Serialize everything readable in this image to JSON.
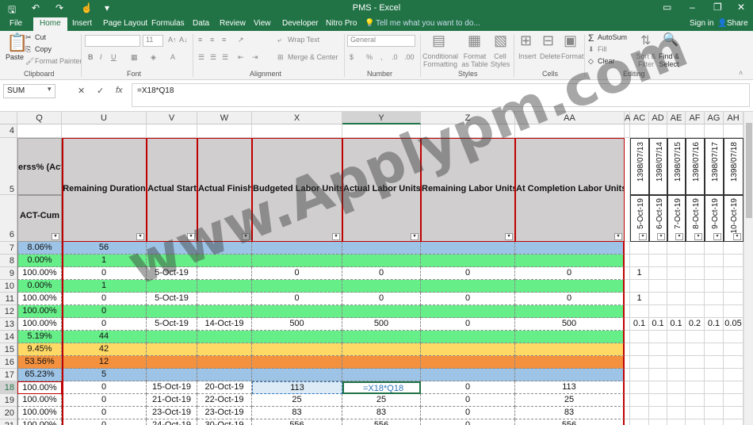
{
  "title": "PMS - Excel",
  "window_buttons": {
    "restore_ribbon": "▭",
    "minimize": "–",
    "maximize": "❐",
    "close": "✕"
  },
  "tabs": [
    "File",
    "Home",
    "Insert",
    "Page Layout",
    "Formulas",
    "Data",
    "Review",
    "View",
    "Developer",
    "Nitro Pro"
  ],
  "tell_me": "Tell me what you want to do...",
  "sign_in": "Sign in",
  "share": "Share",
  "ribbon": {
    "clipboard": {
      "paste": "Paste",
      "cut": "Cut",
      "copy": "Copy",
      "format_painter": "Format Painter",
      "label": "Clipboard"
    },
    "font": {
      "name": "",
      "size": "11",
      "label": "Font",
      "bold": "B",
      "italic": "I",
      "underline": "U"
    },
    "alignment": {
      "wrap": "Wrap Text",
      "merge": "Merge & Center",
      "label": "Alignment"
    },
    "number": {
      "format": "General",
      "label": "Number",
      "currency": "$",
      "percent": "%",
      "comma": ","
    },
    "styles": {
      "conditional": "Conditional Formatting",
      "format_table": "Format as Table",
      "cell_styles": "Cell Styles",
      "label": "Styles"
    },
    "cells": {
      "insert": "Insert",
      "delete": "Delete",
      "format": "Format",
      "label": "Cells"
    },
    "editing": {
      "autosum": "AutoSum",
      "fill": "Fill",
      "clear": "Clear",
      "sort": "Sort & Filter",
      "find": "Find & Select",
      "label": "Editing"
    }
  },
  "name_box": "SUM",
  "formula": "=X18*Q18",
  "formula_buttons": {
    "cancel": "✕",
    "enter": "✓",
    "fx": "fx"
  },
  "columns": [
    "Q",
    "U",
    "V",
    "W",
    "X",
    "Y",
    "Z",
    "AA",
    "A",
    "AC",
    "AD",
    "AE",
    "AF",
    "AG",
    "AH"
  ],
  "header_row5": [
    "erss% (Actu",
    "Remaining Duration",
    "Actual Start",
    "Actual Finish",
    "Budgeted Labor Units",
    "Actual Labor Units",
    "Remaining Labor Units",
    "At Completion Labor Units"
  ],
  "header_row6_q": "ACT-Cum",
  "date_headers_top": [
    "1398/07/13",
    "1398/07/14",
    "1398/07/15",
    "1398/07/16",
    "1398/07/17",
    "1398/07/18"
  ],
  "date_headers_bottom": [
    "5-Oct-19",
    "6-Oct-19",
    "7-Oct-19",
    "8-Oct-19",
    "9-Oct-19",
    "10-Oct-19"
  ],
  "rows": [
    {
      "n": "4",
      "q": "",
      "u": "",
      "v": "",
      "w": "",
      "x": "",
      "y": "",
      "z": "",
      "aa": "",
      "extra": [],
      "color": "#ffffff"
    },
    {
      "n": "7",
      "q": "8.06%",
      "u": "56",
      "v": "",
      "w": "",
      "x": "",
      "y": "",
      "z": "",
      "aa": "",
      "extra": [],
      "color": "#9dc3e6"
    },
    {
      "n": "8",
      "q": "0.00%",
      "u": "1",
      "v": "",
      "w": "",
      "x": "",
      "y": "",
      "z": "",
      "aa": "",
      "extra": [],
      "color": "#66ee88"
    },
    {
      "n": "9",
      "q": "100.00%",
      "u": "0",
      "v": "5-Oct-19",
      "w": "",
      "x": "0",
      "y": "0",
      "z": "0",
      "aa": "0",
      "extra": [
        "1"
      ],
      "color": "#ffffff"
    },
    {
      "n": "10",
      "q": "0.00%",
      "u": "1",
      "v": "",
      "w": "",
      "x": "",
      "y": "",
      "z": "",
      "aa": "",
      "extra": [],
      "color": "#66ee88"
    },
    {
      "n": "11",
      "q": "100.00%",
      "u": "0",
      "v": "5-Oct-19",
      "w": "",
      "x": "0",
      "y": "0",
      "z": "0",
      "aa": "0",
      "extra": [
        "1"
      ],
      "color": "#ffffff"
    },
    {
      "n": "12",
      "q": "100.00%",
      "u": "0",
      "v": "",
      "w": "",
      "x": "",
      "y": "",
      "z": "",
      "aa": "",
      "extra": [],
      "color": "#66ee88"
    },
    {
      "n": "13",
      "q": "100.00%",
      "u": "0",
      "v": "5-Oct-19",
      "w": "14-Oct-19",
      "x": "500",
      "y": "500",
      "z": "0",
      "aa": "500",
      "extra": [
        "0.1",
        "0.1",
        "0.1",
        "0.2",
        "0.1",
        "0.05"
      ],
      "color": "#ffffff"
    },
    {
      "n": "14",
      "q": "5.19%",
      "u": "44",
      "v": "",
      "w": "",
      "x": "",
      "y": "",
      "z": "",
      "aa": "",
      "extra": [],
      "color": "#66ee88"
    },
    {
      "n": "15",
      "q": "9.45%",
      "u": "42",
      "v": "",
      "w": "",
      "x": "",
      "y": "",
      "z": "",
      "aa": "",
      "extra": [],
      "color": "#ffd966"
    },
    {
      "n": "16",
      "q": "53.56%",
      "u": "12",
      "v": "",
      "w": "",
      "x": "",
      "y": "",
      "z": "",
      "aa": "",
      "extra": [],
      "color": "#f4913e"
    },
    {
      "n": "17",
      "q": "65.23%",
      "u": "5",
      "v": "",
      "w": "",
      "x": "",
      "y": "",
      "z": "",
      "aa": "",
      "extra": [],
      "color": "#9dc3e6"
    },
    {
      "n": "18",
      "q": "100.00%",
      "u": "0",
      "v": "15-Oct-19",
      "w": "20-Oct-19",
      "x": "113",
      "y": "=X18*Q18",
      "z": "0",
      "aa": "113",
      "extra": [],
      "color": "#ffffff"
    },
    {
      "n": "19",
      "q": "100.00%",
      "u": "0",
      "v": "21-Oct-19",
      "w": "22-Oct-19",
      "x": "25",
      "y": "25",
      "z": "0",
      "aa": "25",
      "extra": [],
      "color": "#ffffff"
    },
    {
      "n": "20",
      "q": "100.00%",
      "u": "0",
      "v": "23-Oct-19",
      "w": "23-Oct-19",
      "x": "83",
      "y": "83",
      "z": "0",
      "aa": "83",
      "extra": [],
      "color": "#ffffff"
    },
    {
      "n": "21",
      "q": "100.00%",
      "u": "0",
      "v": "24-Oct-19",
      "w": "30-Oct-19",
      "x": "556",
      "y": "556",
      "z": "0",
      "aa": "556",
      "extra": [],
      "color": "#ffffff"
    }
  ],
  "watermark": "www.Applypm.com"
}
